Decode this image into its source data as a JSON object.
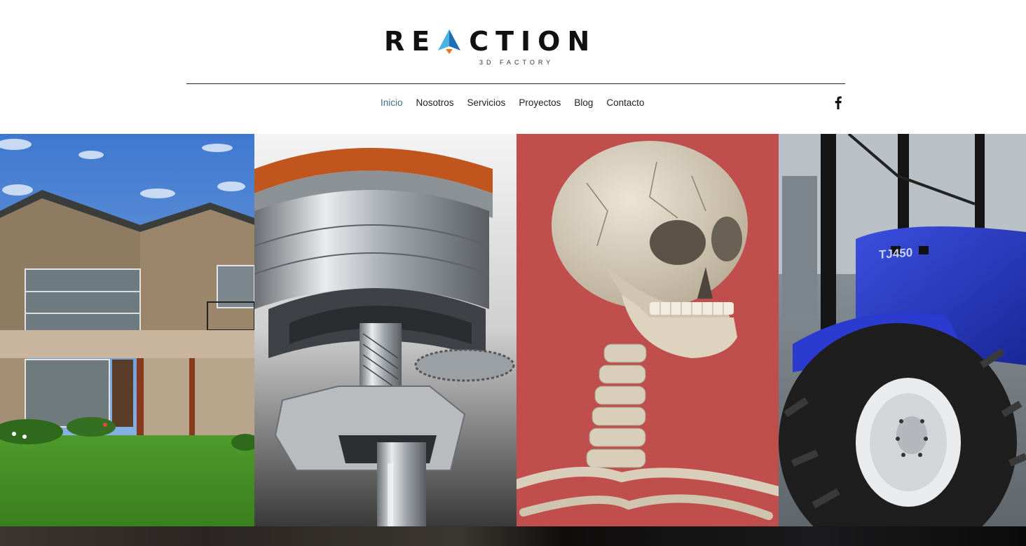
{
  "brand": {
    "name_part1": "RE",
    "name_part2": "CTION",
    "tagline": "3D FACTORY",
    "accent_colors": [
      "#1f6fb5",
      "#4ab3e0",
      "#e8761e"
    ]
  },
  "nav": {
    "items": [
      {
        "label": "Inicio",
        "active": true
      },
      {
        "label": "Nosotros",
        "active": false
      },
      {
        "label": "Servicios",
        "active": false
      },
      {
        "label": "Proyectos",
        "active": false
      },
      {
        "label": "Blog",
        "active": false
      },
      {
        "label": "Contacto",
        "active": false
      }
    ],
    "active_color": "#3e6f84",
    "social_icon": "facebook-icon"
  },
  "hero": {
    "panels": [
      {
        "subject": "house-render",
        "tint": "#5a8fd6"
      },
      {
        "subject": "gear-mechanism-render",
        "tint": "#c9cdd1"
      },
      {
        "subject": "skull-skeleton-render",
        "tint": "#c55553"
      },
      {
        "subject": "tractor-render",
        "tint": "#2a3fbf",
        "label": "TJ450"
      }
    ]
  }
}
